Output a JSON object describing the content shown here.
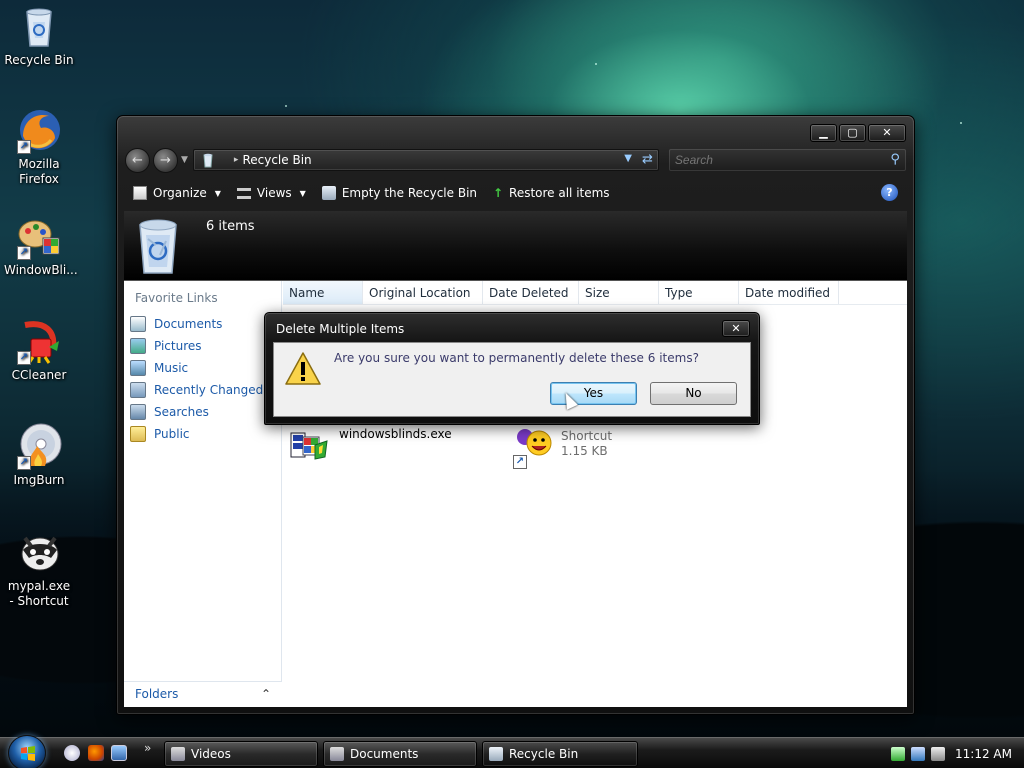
{
  "desktop": {
    "icons": [
      {
        "label": "Recycle Bin",
        "icon": "recycle-bin-icon"
      },
      {
        "label": "Mozilla Firefox",
        "icon": "firefox-icon"
      },
      {
        "label": "WindowBli...",
        "icon": "windowblinds-icon"
      },
      {
        "label": "CCleaner",
        "icon": "ccleaner-icon"
      },
      {
        "label": "ImgBurn",
        "icon": "imgburn-icon"
      },
      {
        "label": "mypal.exe - Shortcut",
        "icon": "mypal-icon"
      }
    ]
  },
  "explorer": {
    "address": "Recycle Bin",
    "search_placeholder": "Search",
    "toolbar": {
      "organize": "Organize",
      "views": "Views",
      "empty": "Empty the Recycle Bin",
      "restore": "Restore all items"
    },
    "item_count": "6 items",
    "favorite_links_title": "Favorite Links",
    "favorites": [
      "Documents",
      "Pictures",
      "Music",
      "Recently Changed",
      "Searches",
      "Public"
    ],
    "folders_label": "Folders",
    "columns": [
      "Name",
      "Original Location",
      "Date Deleted",
      "Size",
      "Type",
      "Date modified"
    ],
    "files": [
      {
        "name": "windowsblinds.exe"
      },
      {
        "type": "Shortcut",
        "size": "1.15 KB"
      }
    ]
  },
  "dialog": {
    "title": "Delete Multiple Items",
    "message": "Are you sure you want to permanently delete these 6 items?",
    "yes": "Yes",
    "no": "No"
  },
  "taskbar": {
    "tasks": [
      "Videos",
      "Documents",
      "Recycle Bin"
    ],
    "clock": "11:12 AM",
    "more_glyph": "»"
  },
  "colors": {
    "link": "#1c5aa8",
    "dialog_text": "#3b3b6b",
    "default_button": "#3c7fb1"
  }
}
